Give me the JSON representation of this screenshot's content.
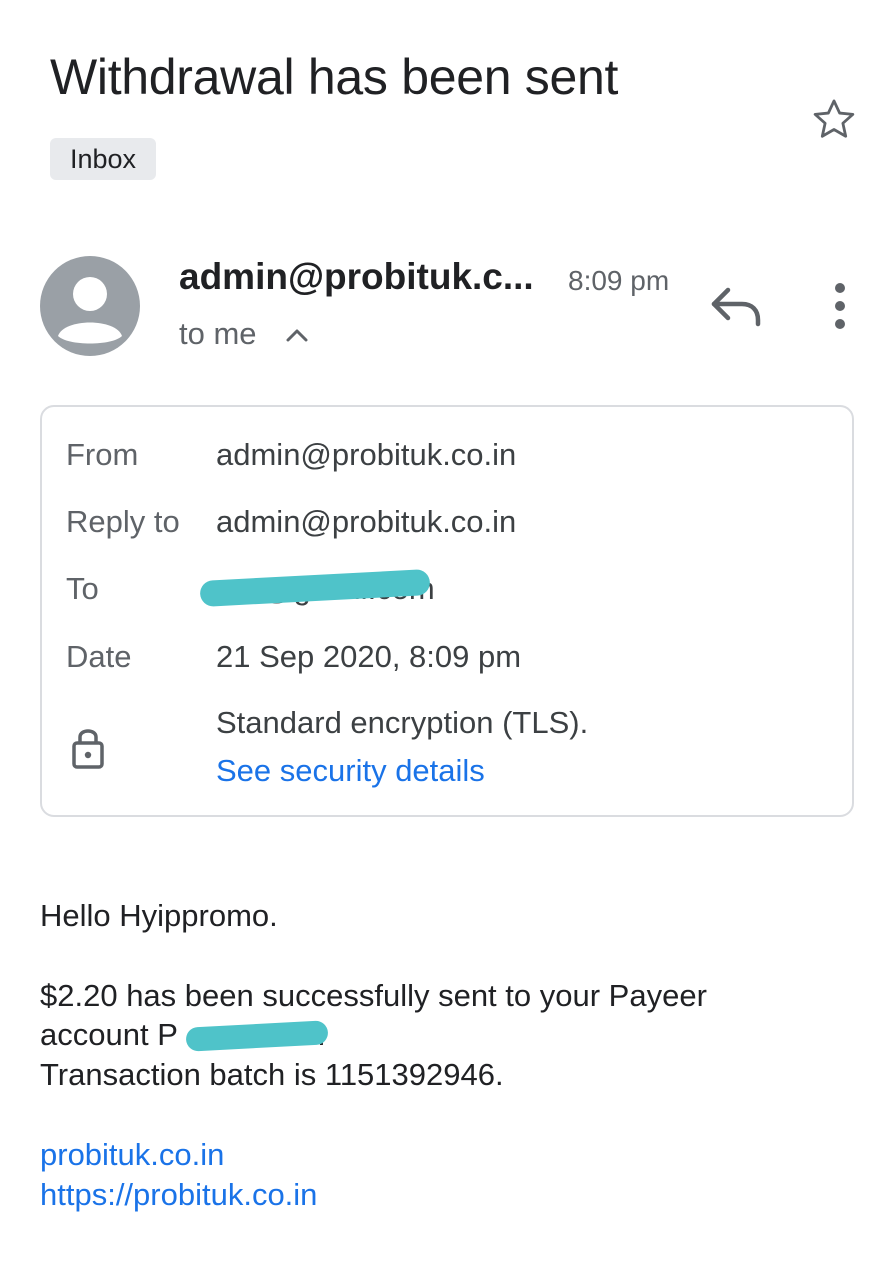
{
  "email": {
    "subject": "Withdrawal has been sent",
    "label": "Inbox",
    "sender_display": "admin@probituk.c...",
    "time": "8:09 pm",
    "recipient_summary": "to me"
  },
  "details": {
    "from_label": "From",
    "from_value": "admin@probituk.co.in",
    "reply_to_label": "Reply to",
    "reply_to_value": "admin@probituk.co.in",
    "to_label": "To",
    "to_value_visible": "gmail.com",
    "date_label": "Date",
    "date_value": "21 Sep 2020, 8:09 pm",
    "encryption_text": "Standard encryption (TLS).",
    "security_link": "See security details"
  },
  "body": {
    "greeting": "Hello Hyippromo.",
    "line1": "$2.20 has been successfully sent to your Payeer",
    "line2_prefix": "account P",
    "line2_suffix": "4.",
    "line3": "Transaction batch is 1151392946.",
    "link1": "probituk.co.in",
    "link2": "https://probituk.co.in"
  },
  "icons": {
    "star": "star-outline-icon",
    "avatar": "person-icon",
    "chevron": "chevron-up-icon",
    "reply": "reply-icon",
    "more": "more-vert-icon",
    "lock": "lock-icon"
  },
  "colors": {
    "link": "#1a73e8",
    "secondary_text": "#5f6368",
    "chip_bg": "#e8eaed",
    "avatar_bg": "#9aa0a6",
    "redaction": "#4fc3c9"
  }
}
